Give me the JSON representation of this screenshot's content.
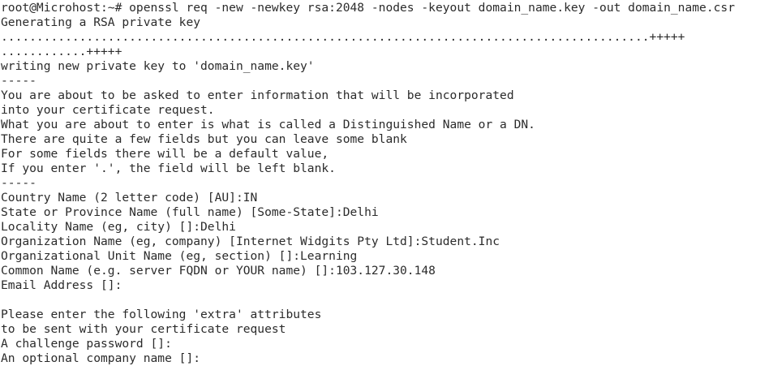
{
  "terminal": {
    "lines": [
      "root@Microhost:~# openssl req -new -newkey rsa:2048 -nodes -keyout domain_name.key -out domain_name.csr",
      "Generating a RSA private key",
      "...........................................................................................+++++",
      "............+++++",
      "writing new private key to 'domain_name.key'",
      "-----",
      "You are about to be asked to enter information that will be incorporated",
      "into your certificate request.",
      "What you are about to enter is what is called a Distinguished Name or a DN.",
      "There are quite a few fields but you can leave some blank",
      "For some fields there will be a default value,",
      "If you enter '.', the field will be left blank.",
      "-----",
      "Country Name (2 letter code) [AU]:IN",
      "State or Province Name (full name) [Some-State]:Delhi",
      "Locality Name (eg, city) []:Delhi",
      "Organization Name (eg, company) [Internet Widgits Pty Ltd]:Student.Inc",
      "Organizational Unit Name (eg, section) []:Learning",
      "Common Name (e.g. server FQDN or YOUR name) []:103.127.30.148",
      "Email Address []:",
      "",
      "Please enter the following 'extra' attributes",
      "to be sent with your certificate request",
      "A challenge password []:",
      "An optional company name []:",
      "_"
    ]
  }
}
